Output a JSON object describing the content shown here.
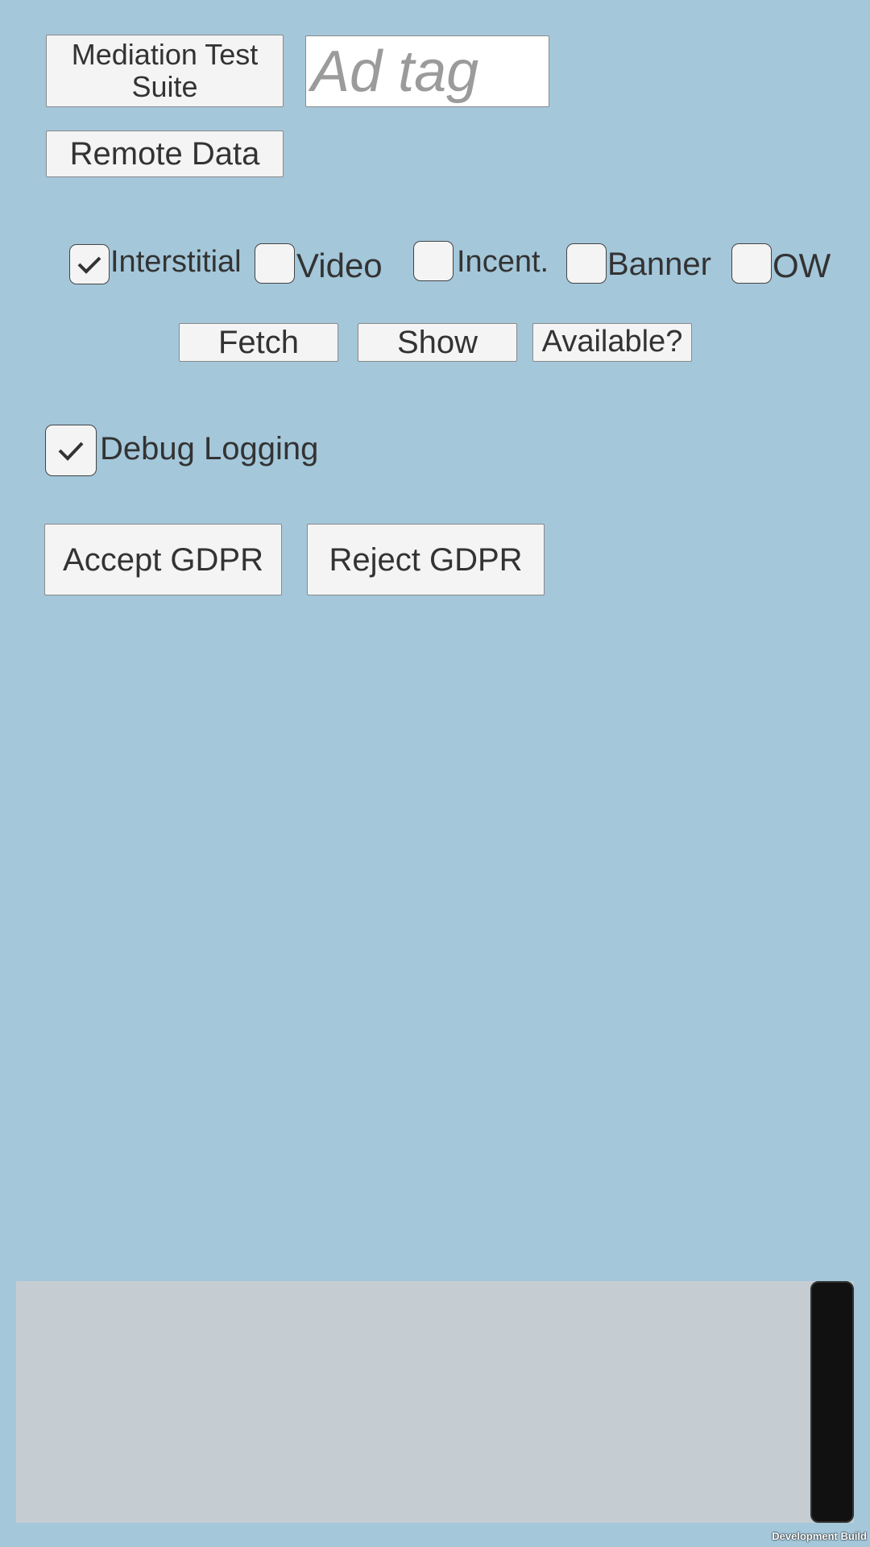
{
  "top": {
    "mediation_label": "Mediation Test Suite",
    "ad_tag_placeholder": "Ad tag",
    "remote_data_label": "Remote Data"
  },
  "ad_types": [
    {
      "label": "Interstitial",
      "checked": true
    },
    {
      "label": "Video",
      "checked": false
    },
    {
      "label": "Incent.",
      "checked": false
    },
    {
      "label": "Banner",
      "checked": false
    },
    {
      "label": "OW",
      "checked": false
    }
  ],
  "actions": {
    "fetch_label": "Fetch",
    "show_label": "Show",
    "available_label": "Available?"
  },
  "debug": {
    "label": "Debug Logging",
    "checked": true
  },
  "gdpr": {
    "accept_label": "Accept GDPR",
    "reject_label": "Reject GDPR"
  },
  "footer": {
    "dev_build": "Development Build"
  }
}
